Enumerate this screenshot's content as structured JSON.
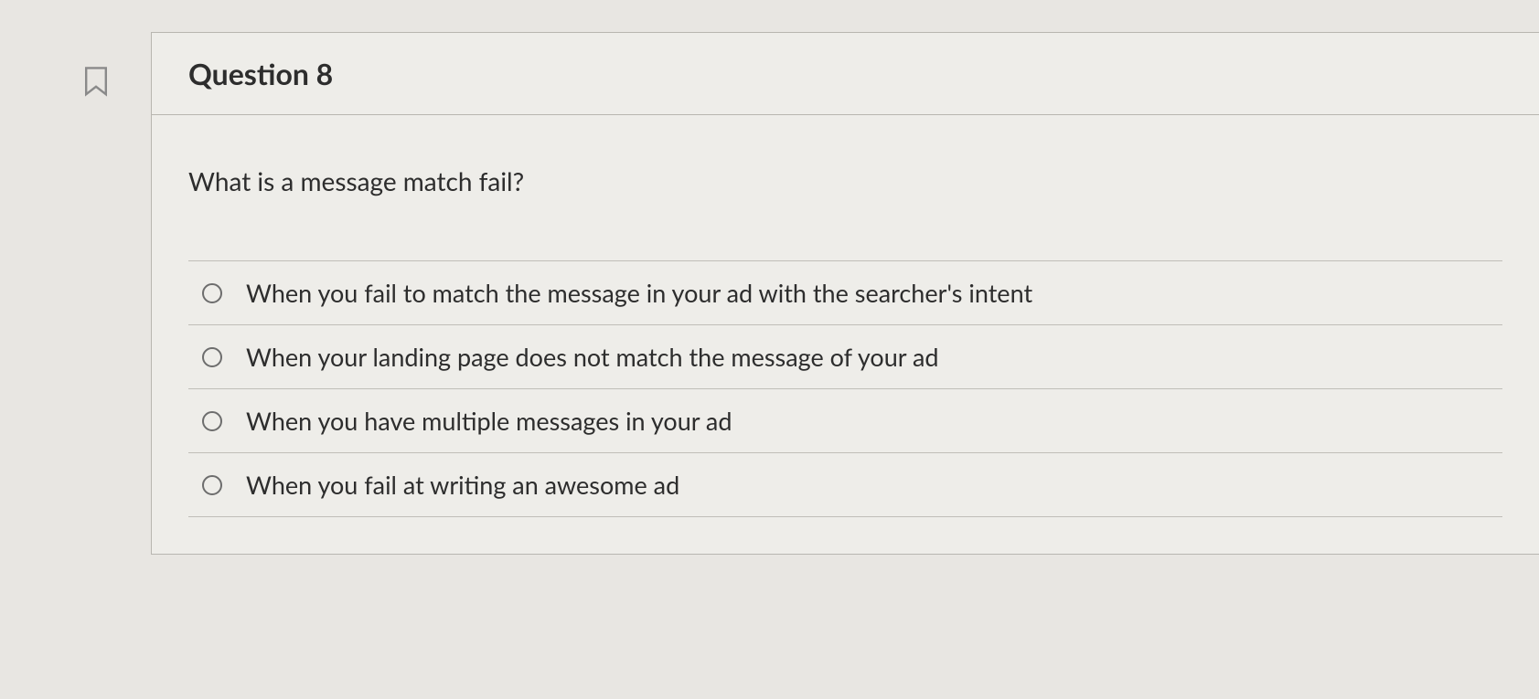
{
  "question": {
    "title": "Question 8",
    "prompt": "What is a message match fail?",
    "options": [
      "When you fail to match the message in your ad with the searcher's intent",
      "When your landing page does not match the message of your ad",
      "When you have multiple messages in your ad",
      "When you fail at writing an awesome ad"
    ]
  }
}
